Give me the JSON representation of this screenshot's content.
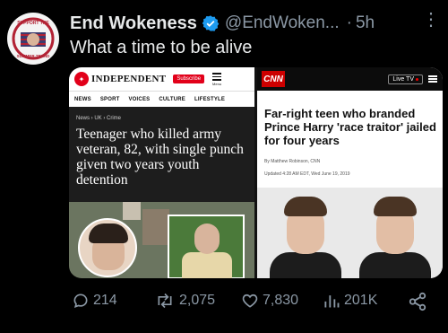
{
  "tweet": {
    "author_name": "End Wokeness",
    "handle": "@EndWoken...",
    "separator": "·",
    "time": "5h",
    "text": "What a time to be alive",
    "avatar_text_top": "SUPPORT THE",
    "avatar_text_bottom": "SUMMER TREND"
  },
  "independent": {
    "logo_text": "INDEPENDENT",
    "subscribe_label": "Subscribe",
    "menu_label": "Menu",
    "nav": [
      "NEWS",
      "SPORT",
      "VOICES",
      "CULTURE",
      "LIFESTYLE"
    ],
    "breadcrumb": "News › UK › Crime",
    "headline": "Teenager who killed army veteran, 82, with single punch given two years youth detention"
  },
  "cnn": {
    "logo_text": "CNN",
    "live_label": "Live TV",
    "headline": "Far-right teen who branded Prince Harry 'race traitor' jailed for four years",
    "byline": "By Matthew Robinson, CNN",
    "updated": "Updated 4:28 AM EDT, Wed June 19, 2019"
  },
  "actions": {
    "replies": "214",
    "reposts": "2,075",
    "likes": "7,830",
    "views": "201K"
  },
  "colors": {
    "background": "#000000",
    "text": "#e7e9ea",
    "muted": "#8b98a5",
    "verified": "#1d9bf0",
    "cnn_red": "#cc0000",
    "independent_red": "#e2001a"
  }
}
